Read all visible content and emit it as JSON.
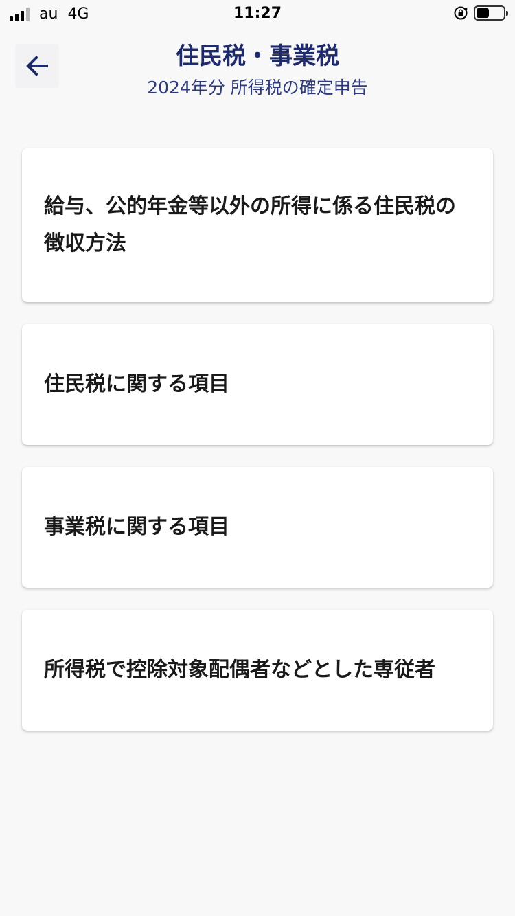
{
  "status_bar": {
    "carrier": "au",
    "network": "4G",
    "time": "11:27",
    "battery_level": 0.48
  },
  "header": {
    "title": "住民税・事業税",
    "subtitle": "2024年分 所得税の確定申告",
    "back_icon": "arrow-left-icon",
    "accent_color": "#1f2a6b"
  },
  "menu": {
    "items": [
      {
        "label": "給与、公的年金等以外の所得に係る住民税の徴収方法"
      },
      {
        "label": "住民税に関する項目"
      },
      {
        "label": "事業税に関する項目"
      },
      {
        "label": "所得税で控除対象配偶者などとした専従者"
      }
    ]
  }
}
